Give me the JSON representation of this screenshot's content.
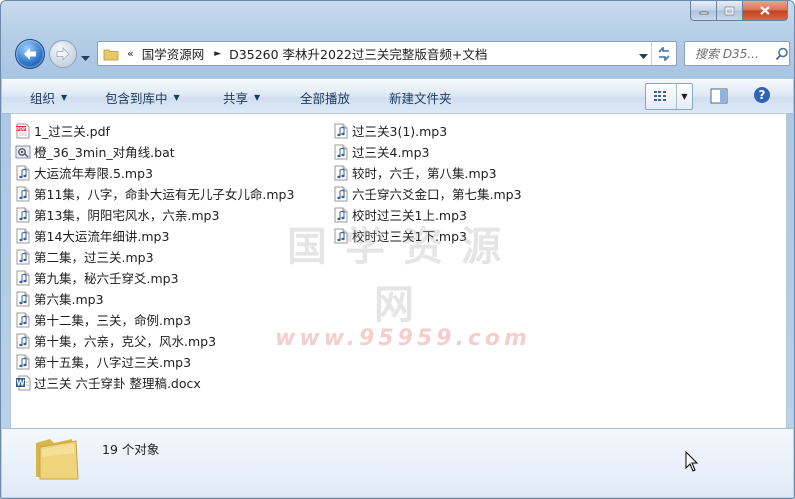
{
  "window": {
    "breadcrumb": [
      "国学资源网",
      "D35260 李林升2022过三关完整版音频+文档"
    ],
    "breadcrumb_prefix": "«",
    "search_placeholder": "搜索 D35..."
  },
  "toolbar": {
    "organize": "组织",
    "include_in_library": "包含到库中",
    "share": "共享",
    "play_all": "全部播放",
    "new_folder": "新建文件夹"
  },
  "files_col1": [
    {
      "name": "1_过三关.pdf",
      "icon": "pdf-icon"
    },
    {
      "name": "橙_36_3min_对角线.bat",
      "icon": "bat-icon"
    },
    {
      "name": "大运流年寿限.5.mp3",
      "icon": "audio-file-icon"
    },
    {
      "name": "第11集，八字，命卦大运有无儿子女儿命.mp3",
      "icon": "audio-file-icon"
    },
    {
      "name": "第13集，阴阳宅风水，六亲.mp3",
      "icon": "audio-file-icon"
    },
    {
      "name": "第14大运流年细讲.mp3",
      "icon": "audio-file-icon"
    },
    {
      "name": "第二集，过三关.mp3",
      "icon": "audio-file-icon"
    },
    {
      "name": "第九集，秘六壬穿爻.mp3",
      "icon": "audio-file-icon"
    },
    {
      "name": "第六集.mp3",
      "icon": "audio-file-icon"
    },
    {
      "name": "第十二集，三关，命例.mp3",
      "icon": "audio-file-icon"
    },
    {
      "name": "第十集，六亲，克父，风水.mp3",
      "icon": "audio-file-icon"
    },
    {
      "name": "第十五集，八字过三关.mp3",
      "icon": "audio-file-icon"
    },
    {
      "name": "过三关 六壬穿卦 整理稿.docx",
      "icon": "word-doc-icon"
    }
  ],
  "files_col2": [
    {
      "name": "过三关3(1).mp3",
      "icon": "audio-file-icon"
    },
    {
      "name": "过三关4.mp3",
      "icon": "audio-file-icon"
    },
    {
      "name": "较时，六壬，第八集.mp3",
      "icon": "audio-file-icon"
    },
    {
      "name": "六壬穿六爻金口，第七集.mp3",
      "icon": "audio-file-icon"
    },
    {
      "name": "校时过三关1上.mp3",
      "icon": "audio-file-icon"
    },
    {
      "name": "校时过三关1下.mp3",
      "icon": "audio-file-icon"
    }
  ],
  "watermark": {
    "line1": "国学资源网",
    "line2": "www.95959.com"
  },
  "details": {
    "status": "19 个对象"
  }
}
